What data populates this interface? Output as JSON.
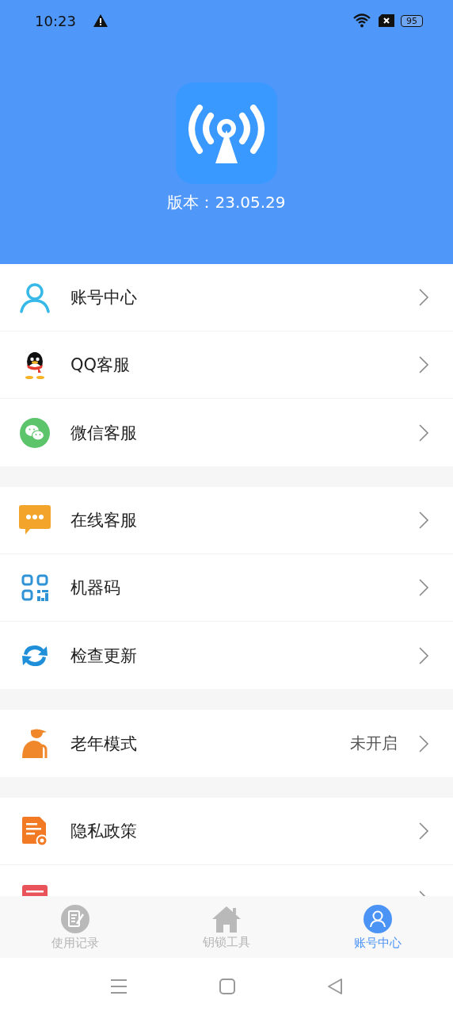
{
  "status_bar": {
    "time": "10:23",
    "battery": "95"
  },
  "header": {
    "version": "版本：23.05.29"
  },
  "groups": [
    [
      {
        "kind": "person",
        "label": "账号中心"
      },
      {
        "kind": "penguin",
        "label": "QQ客服"
      },
      {
        "kind": "wechat",
        "label": "微信客服"
      }
    ],
    [
      {
        "kind": "chat",
        "label": "在线客服"
      },
      {
        "kind": "qr",
        "label": "机器码"
      },
      {
        "kind": "refresh",
        "label": "检查更新"
      }
    ],
    [
      {
        "kind": "elder",
        "label": "老年模式",
        "value": "未开启"
      }
    ],
    [
      {
        "kind": "document",
        "label": "隐私政策"
      },
      {
        "kind": "list"
      }
    ]
  ],
  "tabs": [
    {
      "kind": "record",
      "label": "使用记录",
      "selected": false
    },
    {
      "kind": "home",
      "label": "钥锁工具",
      "selected": false
    },
    {
      "kind": "account",
      "label": "账号中心",
      "selected": true
    }
  ]
}
